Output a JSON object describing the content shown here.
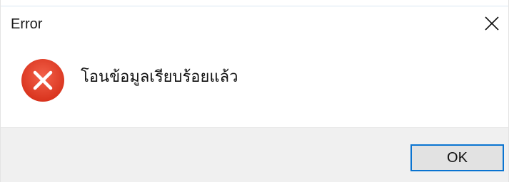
{
  "window": {
    "title": "Error",
    "close_icon": "close-icon"
  },
  "content": {
    "icon": "error-icon",
    "icon_color": "#e8432d",
    "message": "โอนข้อมูลเรียบร้อยแล้ว"
  },
  "footer": {
    "ok_label": "OK",
    "accent_color": "#0a74d1"
  }
}
